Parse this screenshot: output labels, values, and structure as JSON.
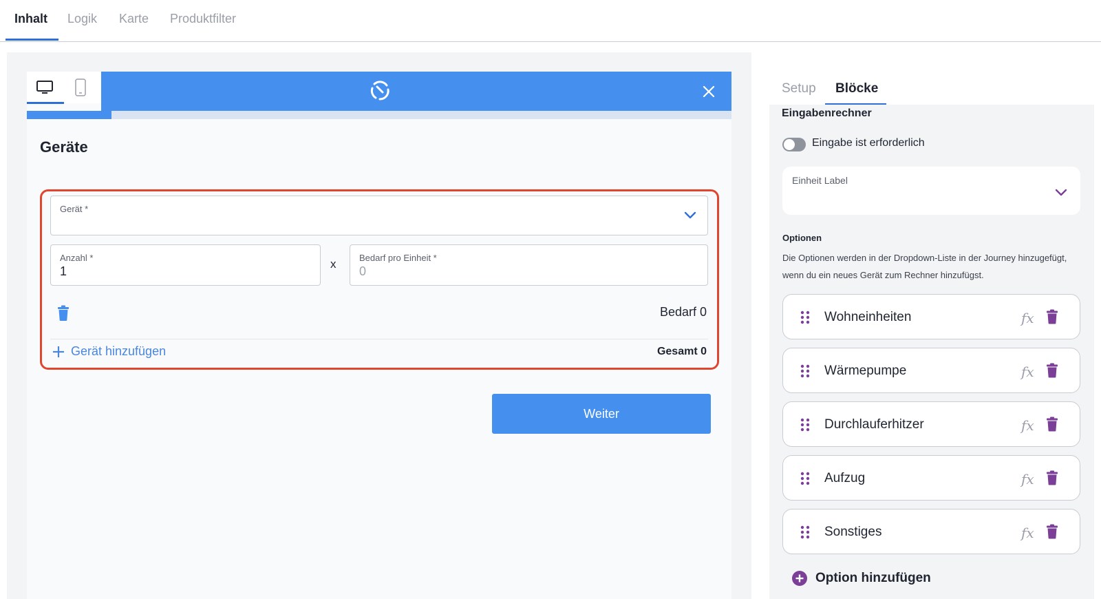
{
  "top_tabs": [
    "Inhalt",
    "Logik",
    "Karte",
    "Produktfilter"
  ],
  "preview": {
    "progress_percent": 12,
    "step_title": "Geräte",
    "device_field": {
      "label": "Gerät *",
      "value": ""
    },
    "quantity_field": {
      "label": "Anzahl *",
      "value": "1"
    },
    "multiply_sign": "x",
    "demand_field": {
      "label": "Bedarf pro Einheit *",
      "placeholder": "0"
    },
    "demand_text": "Bedarf 0",
    "add_device_label": "Gerät hinzufügen",
    "total_text": "Gesamt 0",
    "next_button": "Weiter"
  },
  "right_tabs": [
    "Setup",
    "Blöcke"
  ],
  "settings": {
    "section_title": "Eingabenrechner",
    "required_toggle_label": "Eingabe ist erforderlich",
    "required_toggle_on": false,
    "unit_label_field": "Einheit Label",
    "options_title": "Optionen",
    "options_description": "Die Optionen werden in der Dropdown-Liste in der Journey hinzugefügt, wenn du ein neues Gerät zum Rechner hinzufügst.",
    "options": [
      {
        "label": "Wohneinheiten",
        "fx": "fx"
      },
      {
        "label": "Wärmepumpe",
        "fx": "fx"
      },
      {
        "label": "Durchlauferhitzer",
        "fx": "fx"
      },
      {
        "label": "Aufzug",
        "fx": "fx"
      },
      {
        "label": "Sonstiges",
        "fx": "fx"
      }
    ],
    "add_option_label": "Option hinzufügen"
  },
  "colors": {
    "brand_blue": "#4590ee",
    "highlight_red": "#e0452f",
    "accent_purple": "#7b3f98"
  }
}
